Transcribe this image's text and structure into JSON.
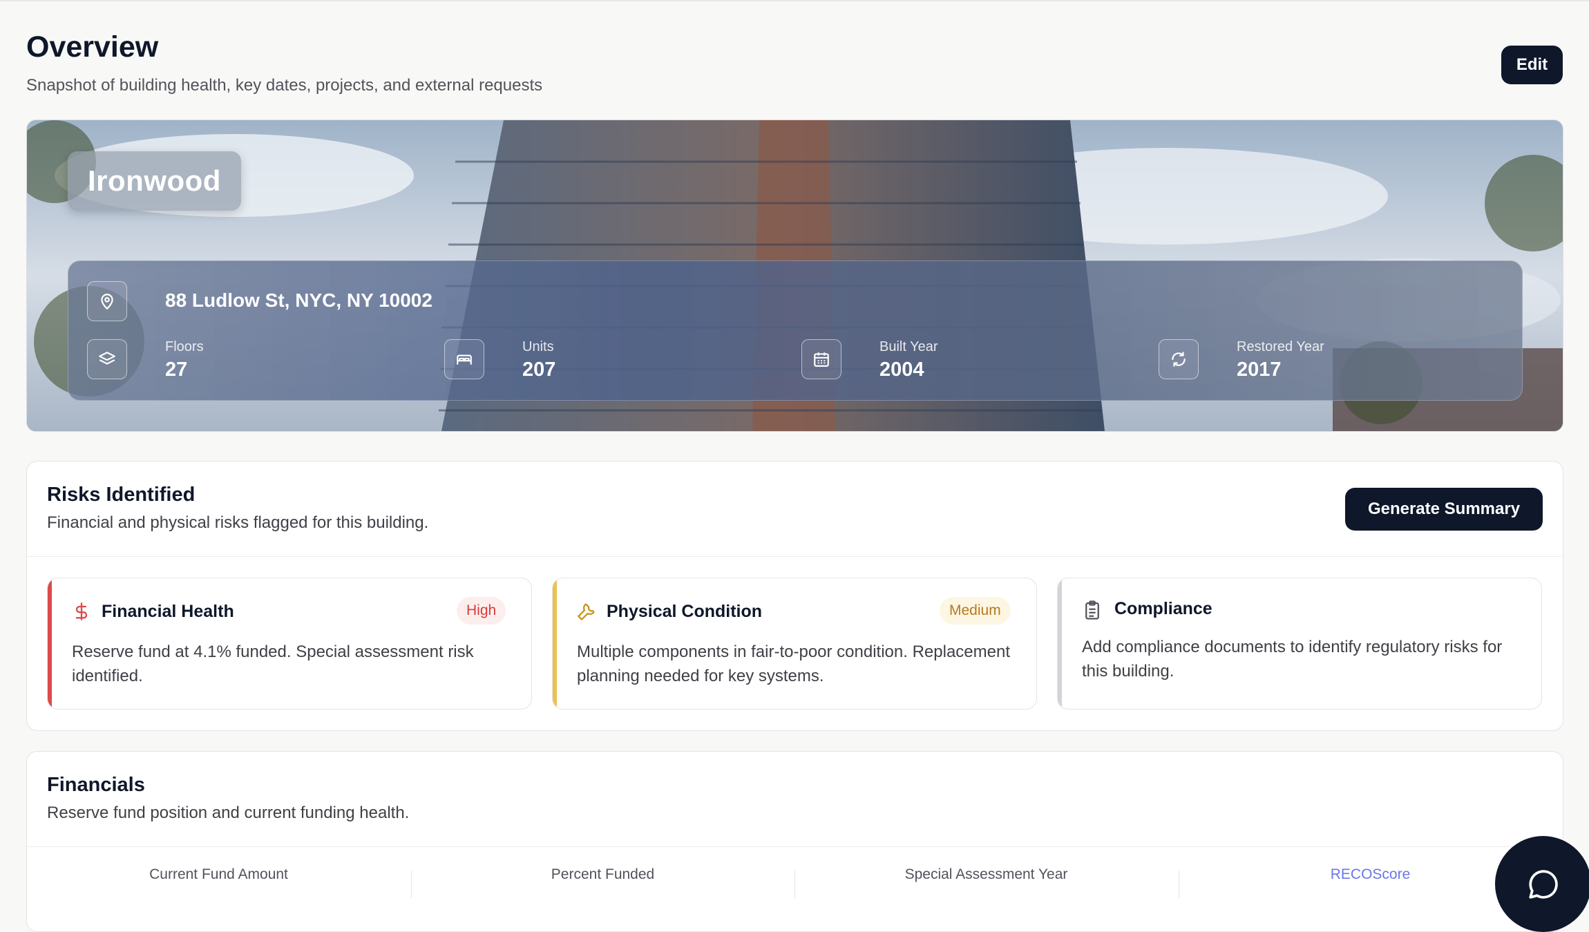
{
  "header": {
    "title": "Overview",
    "subtitle": "Snapshot of building health, key dates, projects, and external requests",
    "edit_label": "Edit"
  },
  "building": {
    "name": "Ironwood",
    "address": "88 Ludlow St, NYC, NY 10002",
    "stats": [
      {
        "label": "Floors",
        "value": "27",
        "icon": "layers-icon"
      },
      {
        "label": "Units",
        "value": "207",
        "icon": "bed-icon"
      },
      {
        "label": "Built Year",
        "value": "2004",
        "icon": "calendar-icon"
      },
      {
        "label": "Restored Year",
        "value": "2017",
        "icon": "refresh-icon"
      }
    ]
  },
  "risks": {
    "title": "Risks Identified",
    "subtitle": "Financial and physical risks flagged for this building.",
    "generate_label": "Generate Summary",
    "items": [
      {
        "title": "Financial Health",
        "badge": "High",
        "icon": "dollar-icon",
        "accent": "#dc4a4a",
        "text": "Reserve fund at 4.1% funded. Special assessment risk identified."
      },
      {
        "title": "Physical Condition",
        "badge": "Medium",
        "icon": "wrench-icon",
        "accent": "#ebc150",
        "text": "Multiple components in fair-to-poor condition. Replacement planning needed for key systems."
      },
      {
        "title": "Compliance",
        "badge": "",
        "icon": "clipboard-icon",
        "accent": "#d4d4d8",
        "text": "Add compliance documents to identify regulatory risks for this building."
      }
    ]
  },
  "financials": {
    "title": "Financials",
    "subtitle": "Reserve fund position and current funding health.",
    "columns": [
      "Current Fund Amount",
      "Percent Funded",
      "Special Assessment Year",
      "RECOScore"
    ]
  },
  "colors": {
    "primary": "#0f172a",
    "high_text": "#d93a3a",
    "high_bg": "#fdeeee",
    "medium_text": "#b7791f",
    "medium_bg": "#fdf6e3",
    "link": "#6b76e6"
  },
  "chat": {
    "icon": "chat-bubble-icon"
  }
}
